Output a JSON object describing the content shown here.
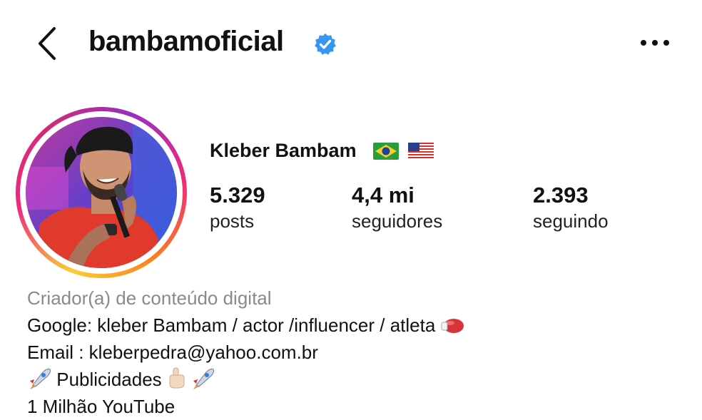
{
  "header": {
    "username": "bambamoficial",
    "back_icon": "chevron-left-icon",
    "verified_icon": "verified-badge-icon",
    "more_icon": "more-horizontal-icon",
    "verified_color": "#3797f0"
  },
  "profile": {
    "display_name": "Kleber Bambam",
    "flags": [
      "brazil-flag",
      "usa-flag"
    ],
    "story_ring_colors": [
      "#f9ce34",
      "#ee2a7b",
      "#962fbf"
    ]
  },
  "stats": [
    {
      "value": "5.329",
      "label": "posts"
    },
    {
      "value": "4,4 mi",
      "label": "seguidores"
    },
    {
      "value": "2.393",
      "label": "seguindo"
    }
  ],
  "bio": {
    "category": "Criador(a) de conteúdo digital",
    "line1": "Google: kleber Bambam / actor /influencer / atleta",
    "line2": "Email : kleberpedra@yahoo.com.br",
    "line3": "Publicidades",
    "line4": "1 Milhão YouTube"
  }
}
